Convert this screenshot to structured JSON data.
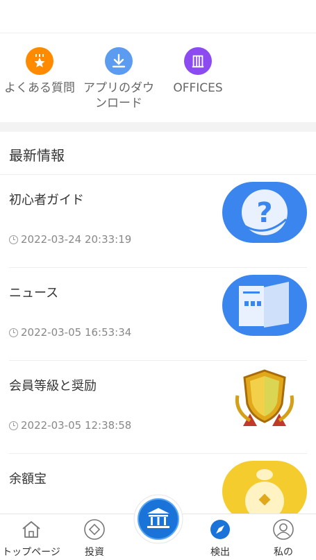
{
  "quick_links": [
    {
      "label": "よくある質問",
      "icon": "star-badge-icon",
      "color": "#ff8a00"
    },
    {
      "label": "アプリのダウンロード",
      "icon": "download-icon",
      "color": "#5b9bf0"
    },
    {
      "label": "OFFICES",
      "icon": "building-icon",
      "color": "#8b4bf0"
    }
  ],
  "section": {
    "title": "最新情報"
  },
  "news": [
    {
      "title": "初心者ガイド",
      "time": "2022-03-24 20:33:19",
      "thumb": "question-bubble-icon"
    },
    {
      "title": "ニュース",
      "time": "2022-03-05 16:53:34",
      "thumb": "book-icon"
    },
    {
      "title": "会員等級と奨励",
      "time": "2022-03-05 12:38:58",
      "thumb": "gold-shield-icon"
    },
    {
      "title": "余額宝",
      "time": "",
      "thumb": "money-bag-icon"
    }
  ],
  "tabs": [
    {
      "label": "トップページ",
      "icon": "home-icon"
    },
    {
      "label": "投資",
      "icon": "diamond-icon"
    },
    {
      "label": "",
      "icon": "bank-icon"
    },
    {
      "label": "検出",
      "icon": "compass-icon"
    },
    {
      "label": "私の",
      "icon": "user-icon"
    }
  ],
  "colors": {
    "accent": "#1a73d8",
    "section_bg": "#f3f3f3"
  }
}
